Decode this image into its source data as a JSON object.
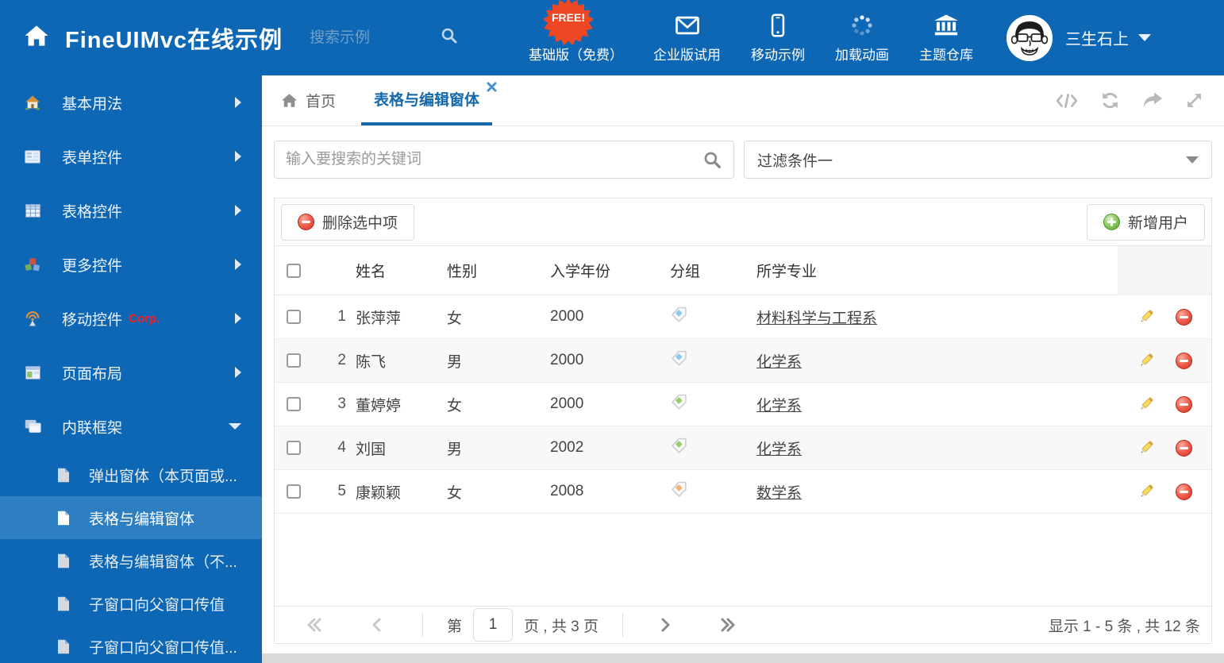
{
  "header": {
    "title": "FineUIMvc在线示例",
    "search_placeholder": "搜索示例",
    "free_badge": "FREE!",
    "nav_items": [
      {
        "label": "基础版（免费）",
        "icon": "download-icon"
      },
      {
        "label": "企业版试用",
        "icon": "envelope-icon"
      },
      {
        "label": "移动示例",
        "icon": "mobile-icon"
      },
      {
        "label": "加载动画",
        "icon": "spinner-icon"
      },
      {
        "label": "主题仓库",
        "icon": "bank-icon"
      }
    ],
    "user_name": "三生石上"
  },
  "sidebar": {
    "items": [
      {
        "label": "基本用法",
        "icon": "house-icon"
      },
      {
        "label": "表单控件",
        "icon": "form-icon"
      },
      {
        "label": "表格控件",
        "icon": "table-icon"
      },
      {
        "label": "更多控件",
        "icon": "cubes-icon"
      },
      {
        "label": "移动控件",
        "icon": "antenna-icon",
        "badge": "Corp."
      },
      {
        "label": "页面布局",
        "icon": "layout-icon"
      },
      {
        "label": "内联框架",
        "icon": "frames-icon"
      }
    ],
    "subitems": [
      {
        "label": "弹出窗体（本页面或..."
      },
      {
        "label": "表格与编辑窗体",
        "selected": true
      },
      {
        "label": "表格与编辑窗体（不..."
      },
      {
        "label": "子窗口向父窗口传值"
      },
      {
        "label": "子窗口向父窗口传值..."
      }
    ]
  },
  "tabs": {
    "home": "首页",
    "active": "表格与编辑窗体"
  },
  "main": {
    "search_placeholder": "输入要搜索的关键词",
    "filter_value": "过滤条件一",
    "delete_button": "删除选中项",
    "add_button": "新增用户",
    "table": {
      "columns": [
        "姓名",
        "性别",
        "入学年份",
        "分组",
        "所学专业"
      ],
      "rows": [
        {
          "num": "1",
          "name": "张萍萍",
          "gender": "女",
          "year": "2000",
          "tag_color": "#8cc8f0",
          "major": "材料科学与工程系"
        },
        {
          "num": "2",
          "name": "陈飞",
          "gender": "男",
          "year": "2000",
          "tag_color": "#8cc8f0",
          "major": "化学系"
        },
        {
          "num": "3",
          "name": "董婷婷",
          "gender": "女",
          "year": "2000",
          "tag_color": "#97cc70",
          "major": "化学系"
        },
        {
          "num": "4",
          "name": "刘国",
          "gender": "男",
          "year": "2002",
          "tag_color": "#97cc70",
          "major": "化学系"
        },
        {
          "num": "5",
          "name": "康颖颖",
          "gender": "女",
          "year": "2008",
          "tag_color": "#f6b26f",
          "major": "数学系"
        }
      ]
    },
    "pagination": {
      "prefix": "第",
      "current_page": "1",
      "suffix": "页 , 共 3 页",
      "summary": "显示 1 - 5 条 , 共 12 条"
    }
  },
  "colors": {
    "primary_blue": "#0d67b5",
    "selected_blue": "#2e7ec2",
    "accent_blue": "#1569ab",
    "free_badge_orange": "#ee4723"
  }
}
